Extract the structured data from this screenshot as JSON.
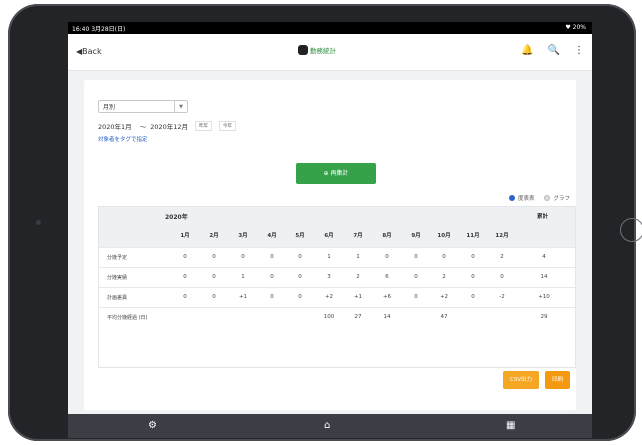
{
  "status": {
    "time": "16:40 3月28日(日)",
    "battery": "♥ 20%"
  },
  "nav": {
    "back_label": "◀Back",
    "brand": "勤務統計",
    "icons": [
      "bell-icon",
      "search-icon",
      "more-vertical-icon"
    ]
  },
  "filters": {
    "period_type": "月別",
    "from": "2020年1月",
    "separator": "〜",
    "to": "2020年12月",
    "chip_last_year": "昨年",
    "chip_this_year": "今年",
    "tag_link": "対象者をタグで指定"
  },
  "actions": {
    "recalc": "⊕ 再集計",
    "csv": "CSV出力",
    "print": "印刷"
  },
  "view_toggle": {
    "table": "度表表",
    "graph": "グラフ"
  },
  "table": {
    "year": "2020年",
    "total_header": "累計",
    "months": [
      "1月",
      "2月",
      "3月",
      "4月",
      "5月",
      "6月",
      "7月",
      "8月",
      "9月",
      "10月",
      "11月",
      "12月"
    ],
    "rows": [
      {
        "label": "分娩予定",
        "values": [
          "0",
          "0",
          "0",
          "0",
          "0",
          "1",
          "1",
          "0",
          "0",
          "0",
          "0",
          "2"
        ],
        "total": "4"
      },
      {
        "label": "分娩実績",
        "values": [
          "0",
          "0",
          "1",
          "0",
          "0",
          "3",
          "2",
          "6",
          "0",
          "2",
          "0",
          "0"
        ],
        "total": "14"
      },
      {
        "label": "計画差異",
        "values": [
          "0",
          "0",
          "+1",
          "0",
          "0",
          "+2",
          "+1",
          "+6",
          "0",
          "+2",
          "0",
          "-2"
        ],
        "total": "+10"
      },
      {
        "label": "平均分娩経過 (日)",
        "values": [
          "",
          "",
          "",
          "",
          "",
          "100",
          "27",
          "14",
          "",
          "47",
          "",
          ""
        ],
        "total": "29"
      }
    ]
  },
  "bottom_nav": [
    "settings-icon",
    "home-icon",
    "calendar-icon"
  ]
}
